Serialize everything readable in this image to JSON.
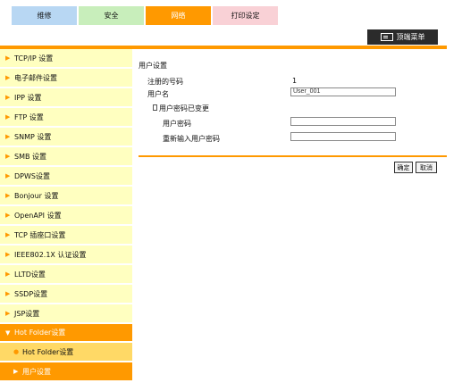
{
  "tabs": [
    "维修",
    "安全",
    "网络",
    "打印设定"
  ],
  "top_menu": {
    "label": "顶端菜单"
  },
  "sidebar": {
    "items": [
      {
        "label": "TCP/IP 设置"
      },
      {
        "label": "电子邮件设置"
      },
      {
        "label": "IPP 设置"
      },
      {
        "label": "FTP 设置"
      },
      {
        "label": "SNMP 设置"
      },
      {
        "label": "SMB 设置"
      },
      {
        "label": "DPWS设置"
      },
      {
        "label": "Bonjour 设置"
      },
      {
        "label": "OpenAPI 设置"
      },
      {
        "label": "TCP 插座口设置"
      },
      {
        "label": "IEEE802.1X 认证设置"
      },
      {
        "label": "LLTD设置"
      },
      {
        "label": "SSDP设置"
      },
      {
        "label": "JSP设置"
      },
      {
        "label": "Hot Folder设置"
      },
      {
        "label": "Hot Folder设置"
      },
      {
        "label": "用户设置"
      }
    ]
  },
  "main": {
    "title": "用户设置",
    "registered_label": "注册的号码",
    "registered_value": "1",
    "username_label": "用户名",
    "username_value": "User_001",
    "change_password_label": "用户密码已变更",
    "password_label": "用户密码",
    "confirm_password_label": "重新输入用户密码",
    "ok_label": "确定",
    "cancel_label": "取消"
  }
}
